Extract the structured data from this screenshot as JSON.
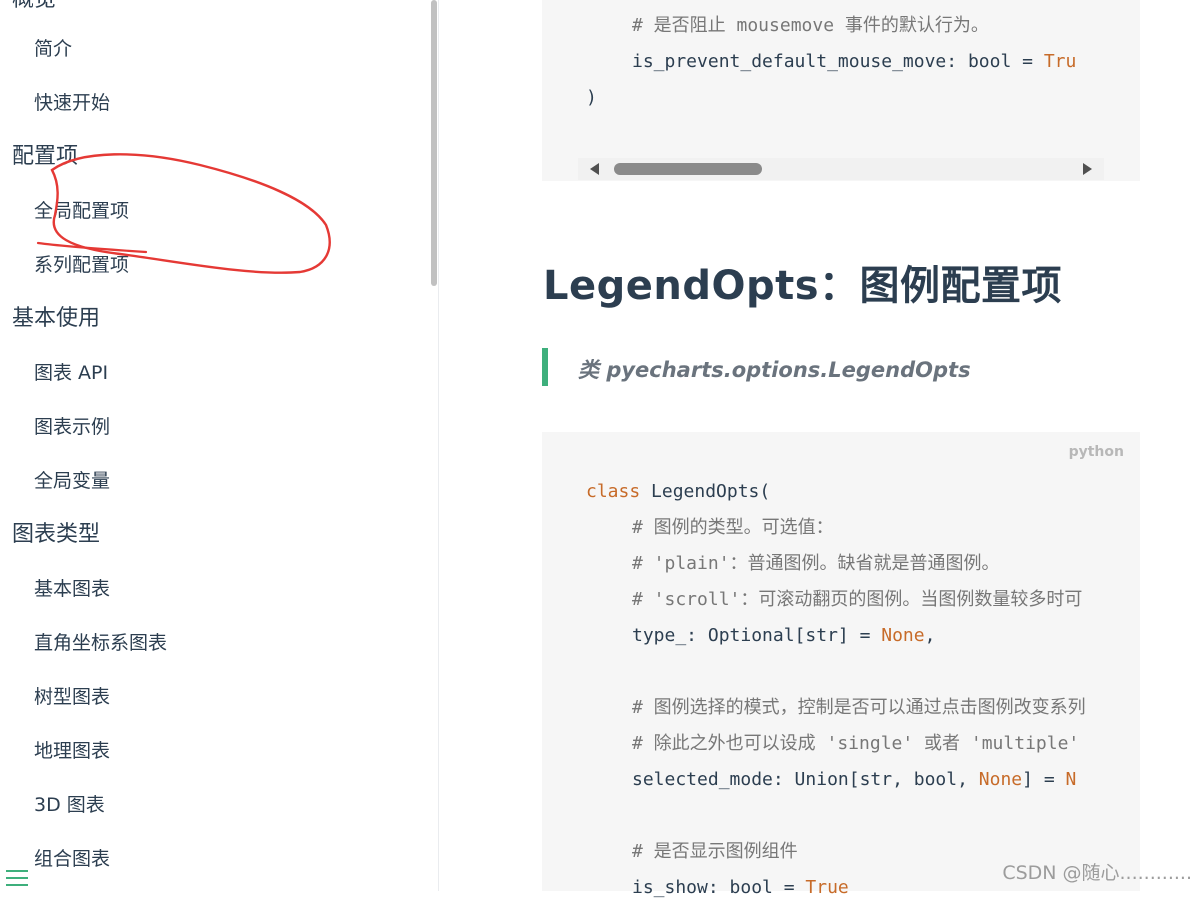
{
  "sidebar": {
    "sections": [
      {
        "title": "概览",
        "items": [
          "简介",
          "快速开始"
        ]
      },
      {
        "title": "配置项",
        "items": [
          "全局配置项",
          "系列配置项"
        ]
      },
      {
        "title": "基本使用",
        "items": [
          "图表 API",
          "图表示例",
          "全局变量"
        ]
      },
      {
        "title": "图表类型",
        "items": [
          "基本图表",
          "直角坐标系图表",
          "树型图表",
          "地理图表",
          "3D 图表",
          "组合图表"
        ]
      }
    ]
  },
  "content": {
    "code_top": {
      "comment": "# 是否阻止 mousemove 事件的默认行为。",
      "line_prefix": "is_prevent_default_mouse_move: bool = ",
      "line_value": "Tru",
      "closing": ")"
    },
    "heading": "LegendOpts：图例配置项",
    "blockquote": {
      "prefix": "类",
      "class_path": "pyecharts.options.LegendOpts"
    },
    "code_bottom": {
      "lang": "python",
      "line1_kw": "class",
      "line1_rest": " LegendOpts(",
      "c1": "# 图例的类型。可选值：",
      "c2": "# 'plain'：普通图例。缺省就是普通图例。",
      "c3": "# 'scroll'：可滚动翻页的图例。当图例数量较多时可",
      "type_prefix": "type_: Optional[str] = ",
      "type_kw": "None",
      "type_suffix": ",",
      "c4": "# 图例选择的模式，控制是否可以通过点击图例改变系列",
      "c5": "# 除此之外也可以设成 'single' 或者 'multiple'",
      "sel_prefix": "selected_mode: Union[str, bool, ",
      "sel_kw": "None",
      "sel_mid": "] = ",
      "sel_kw2": "N",
      "c6": "# 是否显示图例组件",
      "show_prefix": "is_show: bool = ",
      "show_kw": "True"
    },
    "watermark": "CSDN @随心............"
  },
  "colors": {
    "accent": "#3eaf7c",
    "text": "#2c3e50",
    "keyword": "#c76b29",
    "annotation": "#e53935"
  }
}
